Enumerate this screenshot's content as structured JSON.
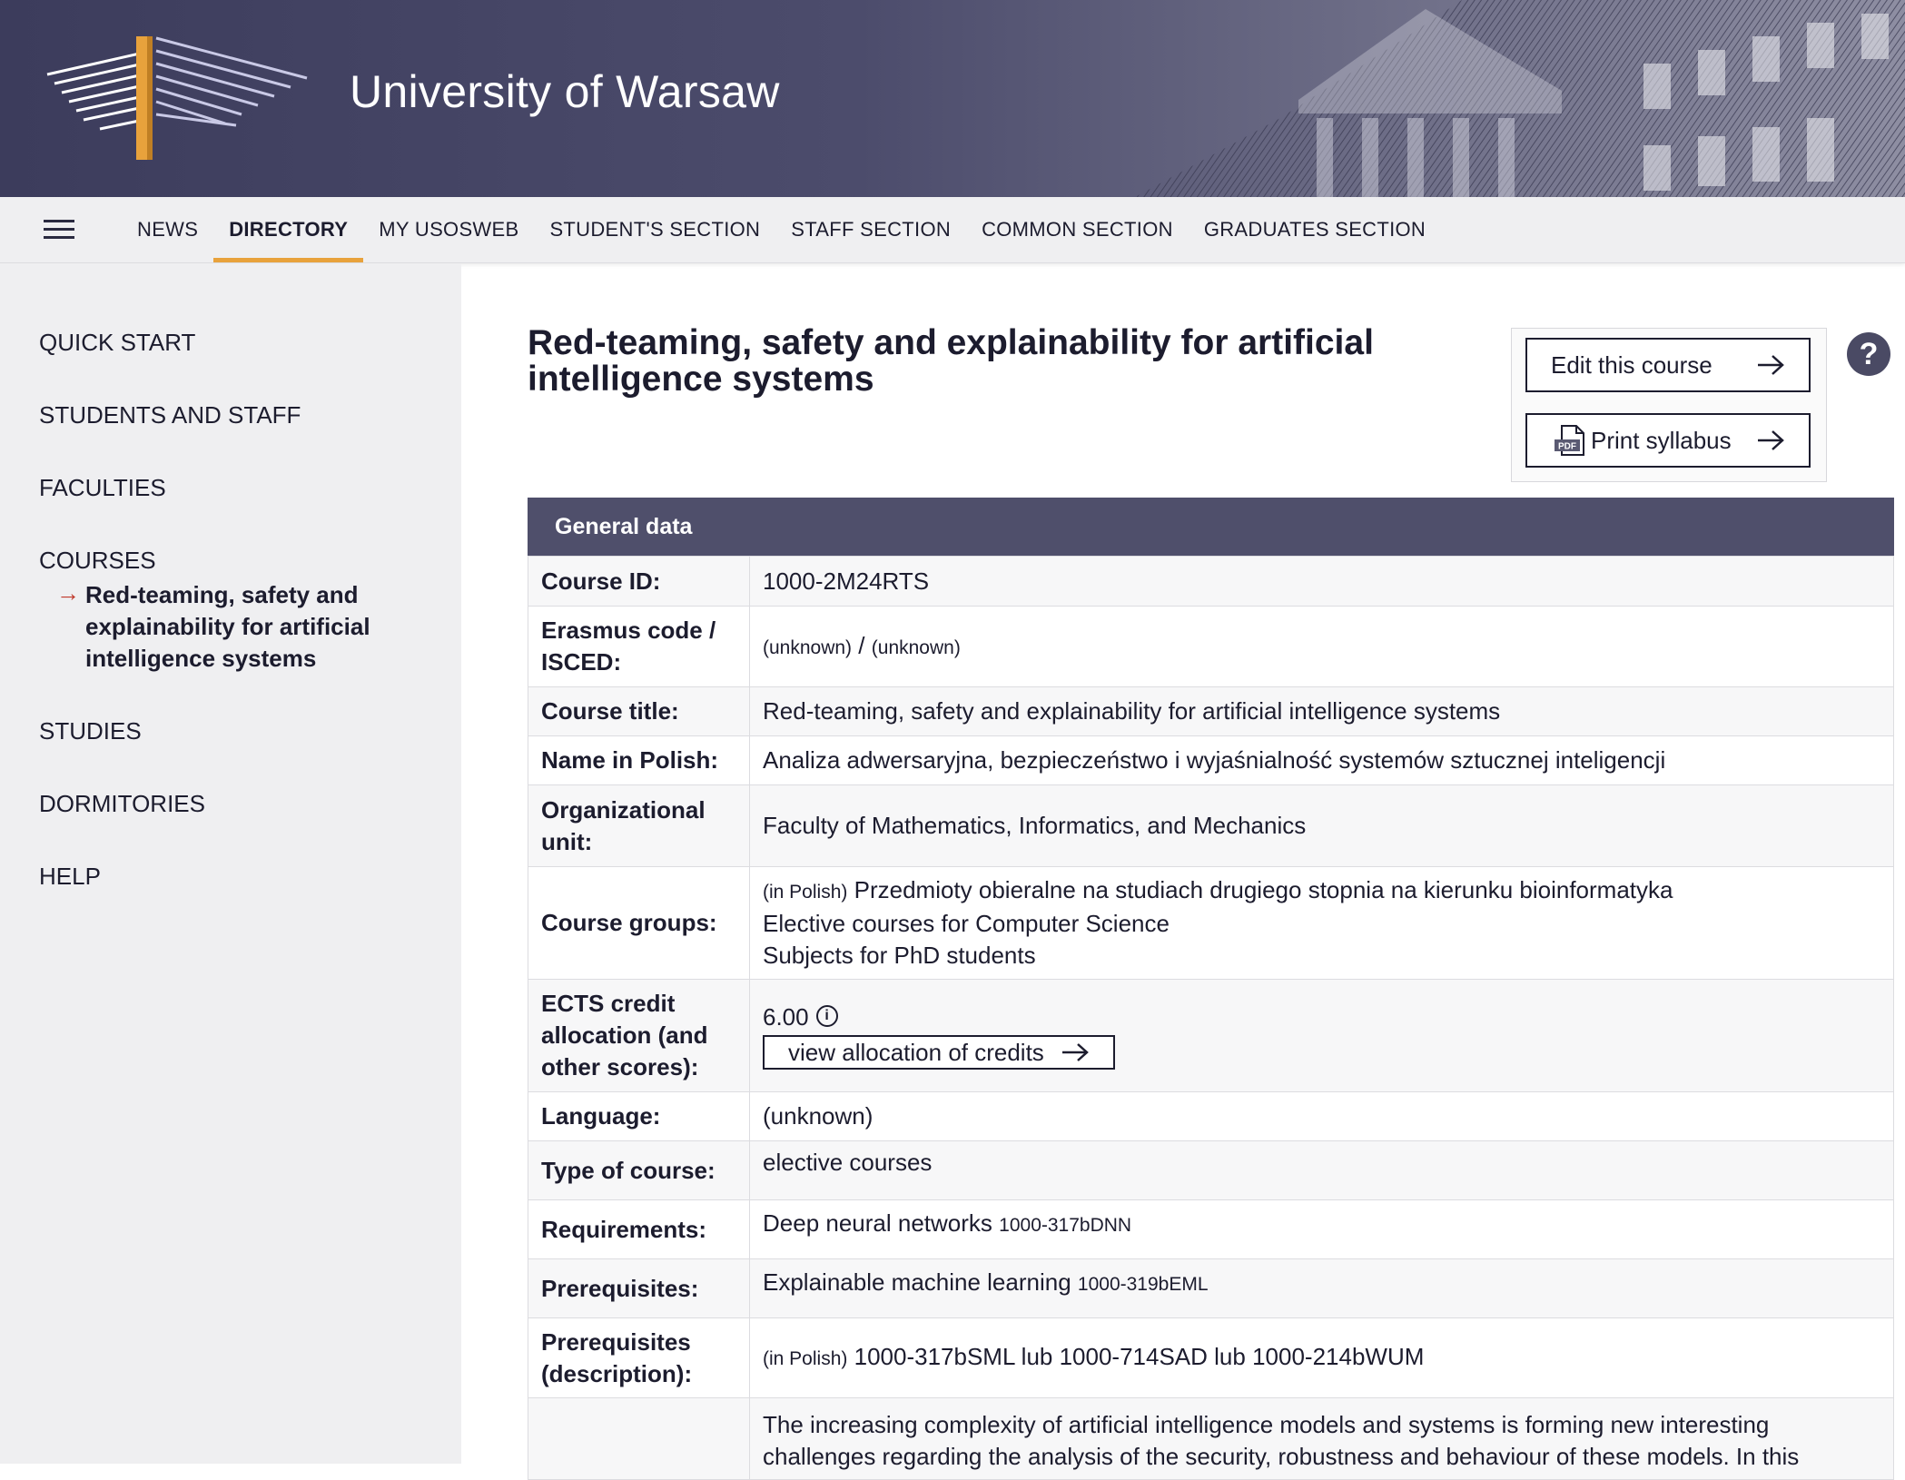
{
  "header": {
    "university_name": "University of Warsaw"
  },
  "nav": {
    "items": [
      {
        "label": "NEWS"
      },
      {
        "label": "DIRECTORY"
      },
      {
        "label": "MY USOSWEB"
      },
      {
        "label": "STUDENT'S SECTION"
      },
      {
        "label": "STAFF SECTION"
      },
      {
        "label": "COMMON SECTION"
      },
      {
        "label": "GRADUATES SECTION"
      }
    ],
    "active": "DIRECTORY"
  },
  "sidebar": {
    "items": [
      {
        "label": "QUICK START"
      },
      {
        "label": "STUDENTS AND STAFF"
      },
      {
        "label": "FACULTIES"
      },
      {
        "label": "COURSES"
      },
      {
        "label": "STUDIES"
      },
      {
        "label": "DORMITORIES"
      },
      {
        "label": "HELP"
      }
    ],
    "sub_item": "Red-teaming, safety and explainability for artificial intelligence systems"
  },
  "main": {
    "title": "Red-teaming, safety and explainability for artificial intelligence systems",
    "edit_button": "Edit this course",
    "print_button": "Print syllabus",
    "pdf_label": "PDF",
    "help": "?"
  },
  "general": {
    "heading": "General data",
    "course_id_label": "Course ID:",
    "course_id": "1000-2M24RTS",
    "erasmus_label": "Erasmus code / ISCED:",
    "erasmus_value1": "(unknown)",
    "erasmus_sep": "/",
    "erasmus_value2": "(unknown)",
    "course_title_label": "Course title:",
    "course_title": "Red-teaming, safety and explainability for artificial intelligence systems",
    "polish_name_label": "Name in Polish:",
    "polish_name": "Analiza adwersaryjna, bezpieczeństwo i wyjaśnialność systemów sztucznej inteligencji",
    "org_unit_label": "Organizational unit:",
    "org_unit": "Faculty of Mathematics, Informatics, and Mechanics",
    "groups_label": "Course groups:",
    "groups_in_polish": "(in Polish)",
    "groups": [
      "Przedmioty obieralne na studiach drugiego stopnia na kierunku bioinformatyka",
      "Elective courses for Computer Science",
      "Subjects for PhD students"
    ],
    "ects_label": "ECTS credit allocation (and other scores):",
    "ects_value": "6.00",
    "ects_button": "view allocation of credits",
    "language_label": "Language:",
    "language_value": "(unknown)",
    "type_label": "Type of course:",
    "type_value": "elective courses",
    "requirements_label": "Requirements:",
    "requirements_value": "Deep neural networks",
    "requirements_code": "1000-317bDNN",
    "prereq_label": "Prerequisites:",
    "prereq_value": "Explainable machine learning",
    "prereq_code": "1000-319bEML",
    "prereq_desc_label": "Prerequisites (description):",
    "prereq_desc_in_polish": "(in Polish)",
    "prereq_desc_value": "1000-317bSML lub 1000-714SAD lub 1000-214bWUM",
    "description_line1": "The increasing complexity of artificial intelligence models and systems is forming new interesting",
    "description_line2": "challenges regarding the analysis of the security, robustness and behaviour of these models. In this"
  }
}
